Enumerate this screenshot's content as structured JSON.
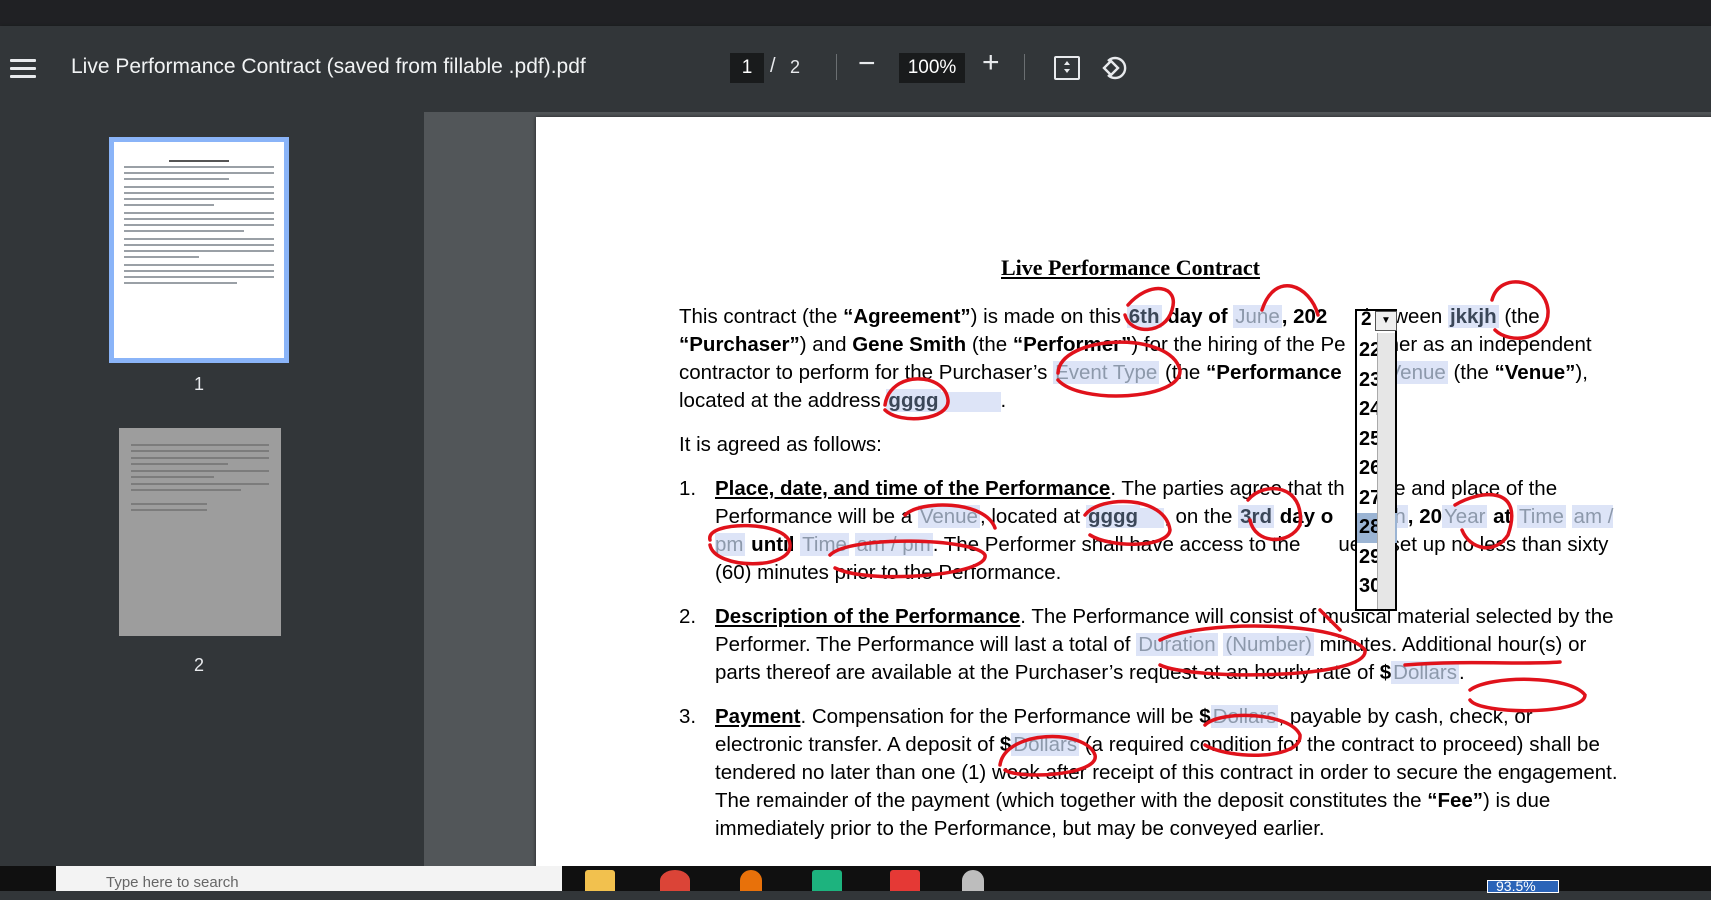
{
  "toolbar": {
    "title": "Live Performance Contract (saved from fillable .pdf).pdf",
    "page_current": "1",
    "page_separator": "/",
    "page_total": "2",
    "zoom_out": "−",
    "zoom": "100%",
    "zoom_in": "+"
  },
  "sidebar": {
    "thumb1_label": "1",
    "thumb2_label": "2"
  },
  "document": {
    "heading": "Live Performance Contract",
    "intro": {
      "t1": "This contract (the ",
      "agreement": "“Agreement”",
      "t2": ") is made on this ",
      "day": "6th",
      "t3": " day of ",
      "month": "June",
      "t4": ", 202",
      "t5": ", between ",
      "purchaser_name": "jkkjh",
      "t6": " (the ",
      "purchaser": "“Purchaser”",
      "t7": ") and ",
      "performer_name": "Gene Smith",
      "t8": " (the ",
      "performer": "“Performer”",
      "t9": ") for the hiring of the Pe",
      "t10": "her as an independent contractor to perform for the Purchaser’s ",
      "event_type": "Event Type",
      "t11": " (the ",
      "performance": "“Performance",
      "t12": " ",
      "venue_field": "Venue",
      "t13": " (the ",
      "venue": "“Venue”",
      "t14": "), located at the address ",
      "address": "gggg",
      "t15": "."
    },
    "agreed": "It is agreed as follows:",
    "items": [
      {
        "num": "1.",
        "heading": "Place, date, and time of the Performance",
        "a": ". The parties agree that th",
        "b": "he and place of the Performance will be a ",
        "venue": "Venue",
        "c": ", located at ",
        "address": "gggg",
        "d": ", on the ",
        "day": "3rd",
        "e": " day o",
        "month": "nth",
        "f": ", 20",
        "year": "Year",
        "g": " at ",
        "time1": "Time",
        "ampm1": "am / pm",
        "h": " until ",
        "time2": "Time",
        "ampm2": "am / pm",
        "i": ". The Performer shall have access to the",
        "j": "ue to set up no less than sixty (60) minutes prior to the Performance."
      },
      {
        "num": "2.",
        "heading": "Description of the Performance",
        "a": ". The Performance will consist of musical material selected by the Performer. The Performance will last a total of ",
        "duration": "Duration",
        "number": "(Number)",
        "b": " minutes. Additional hour(s) or parts thereof are available at the Purchaser’s request at an hourly rate of ",
        "dollars": "$",
        "dollars_field": "Dollars",
        "c": "."
      },
      {
        "num": "3.",
        "heading": "Payment",
        "a": ". Compensation for the Performance will be ",
        "dollars": "$",
        "dollars_field": "Dollars",
        "b": ", payable by cash, check, or electronic transfer. A deposit of ",
        "deposit": "$",
        "deposit_field": "Dollars",
        "c": " (a required condition for the contract to proceed) shall be tendered no later than one (1) week after receipt of this contract in order to secure the engagement. The remainder of the payment (which together with the deposit constitutes the ",
        "fee": "“Fee”",
        "d": ") is due immediately prior to the Performance, but may be conveyed earlier."
      }
    ]
  },
  "year_dropdown": {
    "current": "2",
    "options": [
      "22",
      "23",
      "24",
      "25",
      "26",
      "27",
      "28",
      "29",
      "30"
    ],
    "selected": "28"
  },
  "taskbar": {
    "search_placeholder": "Type here to search",
    "battery": "93.5%"
  },
  "colors": {
    "toolbar": "#323639",
    "viewer": "#525659",
    "field_bg": "#dde4f7",
    "ink": "#e0121b",
    "thumb_selected": "#8ab4f8"
  }
}
